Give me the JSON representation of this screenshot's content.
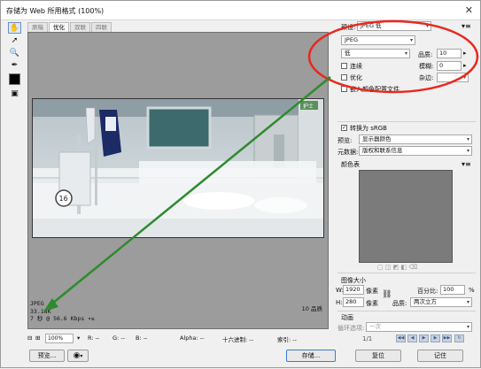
{
  "window": {
    "title": "存储为 Web 所用格式 (100%)"
  },
  "tabs": [
    {
      "label": "原稿"
    },
    {
      "label": "优化"
    },
    {
      "label": "双联"
    },
    {
      "label": "四联"
    }
  ],
  "preview_info": {
    "format": "JPEG",
    "size": "33.18K",
    "time": "7 秒 @ 56.6 Kbps",
    "quality_text": "10 品质"
  },
  "status": {
    "zoom": "100%",
    "r": "R: --",
    "g": "G: --",
    "b": "B: --",
    "alpha": "Alpha: --",
    "hex": "十六进制: --",
    "index": "索引: --"
  },
  "buttons": {
    "preview": "预览...",
    "save": "存储...",
    "reset": "复位",
    "remember": "记住"
  },
  "settings": {
    "preset_label": "预设:",
    "preset_value": "JPEG 低",
    "format_value": "JPEG",
    "quality_preset": "低",
    "quality_label": "品质:",
    "quality_value": "10",
    "progressive_label": "连续",
    "blur_label": "模糊:",
    "blur_value": "0",
    "optimized_label": "优化",
    "matte_label": "杂边:",
    "embed_profile_label": "嵌入颜色配置文件",
    "convert_srgb_label": "转换为 sRGB",
    "preview_label": "预览:",
    "preview_value": "显示器颜色",
    "metadata_label": "元数据:",
    "metadata_value": "版权和联系信息"
  },
  "color_table": {
    "label": "颜色表"
  },
  "image_size": {
    "label": "图像大小",
    "w_label": "W:",
    "w_value": "1920",
    "h_label": "H:",
    "h_value": "280",
    "unit": "像素",
    "percent_label": "百分比:",
    "percent_value": "100",
    "percent_unit": "%",
    "quality_label": "品质:",
    "quality_value": "两次立方"
  },
  "animation": {
    "label": "动画",
    "loop_label": "循环选项:",
    "loop_value": "一次",
    "frame": "1/1"
  },
  "photo_labels": {
    "bed_number": "16",
    "sign": "护士"
  },
  "colors": {
    "annotation_red": "#e8281e",
    "annotation_green": "#2e8b2e"
  }
}
